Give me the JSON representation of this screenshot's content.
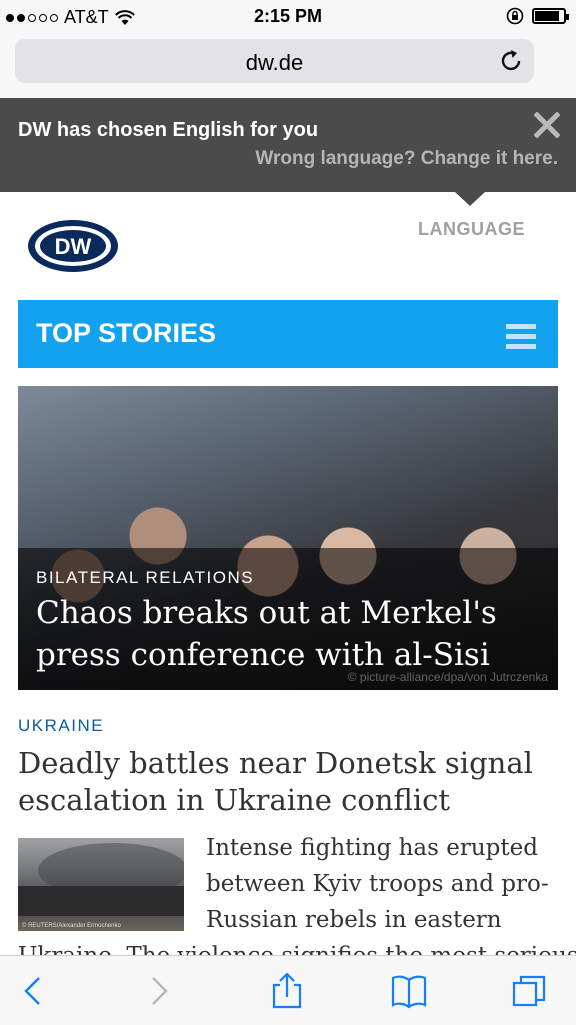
{
  "status": {
    "carrier": "AT&T",
    "time": "2:15 PM",
    "signal_filled": 2,
    "signal_total": 5
  },
  "browser": {
    "url": "dw.de"
  },
  "banner": {
    "message": "DW has chosen English for you",
    "link": "Wrong language? Change it here."
  },
  "header": {
    "language_label": "LANGUAGE"
  },
  "topstories": {
    "title": "TOP STORIES"
  },
  "hero": {
    "kicker": "BILATERAL RELATIONS",
    "headline": "Chaos breaks out at Merkel's press conference with al-Sisi",
    "credit": "© picture-alliance/dpa/von Jutrczenka"
  },
  "story": {
    "kicker": "UKRAINE",
    "title": "Deadly battles near Donetsk signal escalation in Ukraine conflict",
    "summary": "Intense fighting has erupted between Kyiv troops and pro-Russian rebels in eastern",
    "summary_cont": "Ukraine. The violence signifies the most serious",
    "thumb_credit": "© REUTERS/Alexander Ermochenko"
  },
  "colors": {
    "accent": "#12a2f0",
    "banner": "#4b4b4b",
    "kicker": "#0a5f9c"
  },
  "icons": [
    "wifi-icon",
    "lock-rotation-icon",
    "battery-icon",
    "reload-icon",
    "close-icon",
    "dw-logo",
    "hamburger-icon",
    "back-icon",
    "forward-icon",
    "share-icon",
    "bookmarks-icon",
    "tabs-icon"
  ]
}
